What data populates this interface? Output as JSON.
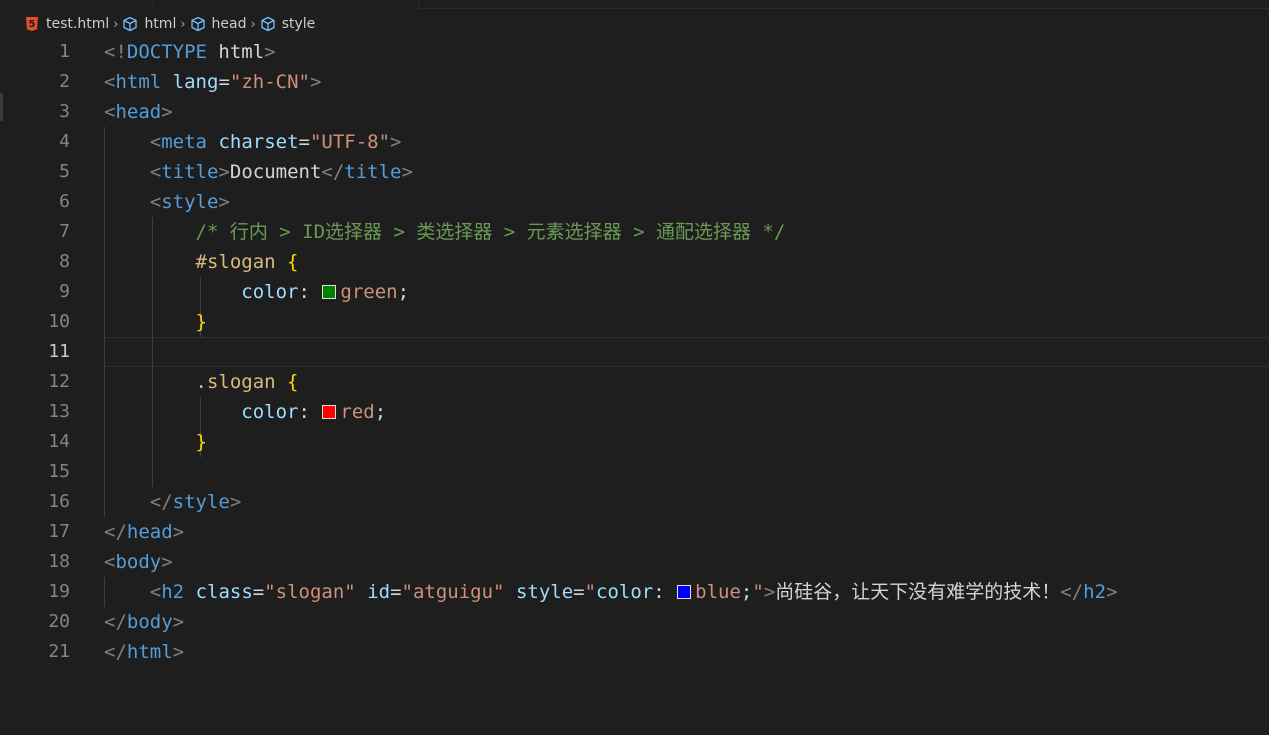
{
  "breadcrumb": {
    "items": [
      {
        "label": "test.html",
        "icon": "html5-file-icon"
      },
      {
        "label": "html",
        "icon": "symbol-cube-icon"
      },
      {
        "label": "head",
        "icon": "symbol-cube-icon"
      },
      {
        "label": "style",
        "icon": "symbol-cube-icon"
      }
    ]
  },
  "editor": {
    "current_line": 11,
    "line_numbers": [
      "1",
      "2",
      "3",
      "4",
      "5",
      "6",
      "7",
      "8",
      "9",
      "10",
      "11",
      "12",
      "13",
      "14",
      "15",
      "16",
      "17",
      "18",
      "19",
      "20",
      "21"
    ],
    "colors": {
      "swatch_green": "#008000",
      "swatch_red": "#ff0000",
      "swatch_blue": "#0000ff"
    },
    "lines": [
      [
        [
          "punc",
          "<!"
        ],
        [
          "doc",
          "DOCTYPE "
        ],
        [
          "text",
          "html"
        ],
        [
          "punc",
          ">"
        ]
      ],
      [
        [
          "punc",
          "<"
        ],
        [
          "tag",
          "html"
        ],
        [
          "text",
          " "
        ],
        [
          "attr",
          "lang"
        ],
        [
          "text",
          "="
        ],
        [
          "str",
          "\"zh-CN\""
        ],
        [
          "punc",
          ">"
        ]
      ],
      [
        [
          "punc",
          "<"
        ],
        [
          "tag",
          "head"
        ],
        [
          "punc",
          ">"
        ]
      ],
      [
        [
          "text",
          "    "
        ],
        [
          "punc",
          "<"
        ],
        [
          "tag",
          "meta"
        ],
        [
          "text",
          " "
        ],
        [
          "attr",
          "charset"
        ],
        [
          "text",
          "="
        ],
        [
          "str",
          "\"UTF-8\""
        ],
        [
          "punc",
          ">"
        ]
      ],
      [
        [
          "text",
          "    "
        ],
        [
          "punc",
          "<"
        ],
        [
          "tag",
          "title"
        ],
        [
          "punc",
          ">"
        ],
        [
          "text",
          "Document"
        ],
        [
          "punc",
          "</"
        ],
        [
          "tag",
          "title"
        ],
        [
          "punc",
          ">"
        ]
      ],
      [
        [
          "text",
          "    "
        ],
        [
          "punc",
          "<"
        ],
        [
          "tag",
          "style"
        ],
        [
          "punc",
          ">"
        ]
      ],
      [
        [
          "text",
          "        "
        ],
        [
          "com",
          "/* 行内 > ID选择器 > 类选择器 > 元素选择器 > 通配选择器 */"
        ]
      ],
      [
        [
          "text",
          "        "
        ],
        [
          "sel",
          "#slogan"
        ],
        [
          "text",
          " "
        ],
        [
          "brace",
          "{"
        ]
      ],
      [
        [
          "text",
          "            "
        ],
        [
          "prop",
          "color"
        ],
        [
          "text",
          ": "
        ],
        [
          "swatch",
          "green"
        ],
        [
          "val",
          "green"
        ],
        [
          "text",
          ";"
        ]
      ],
      [
        [
          "text",
          "        "
        ],
        [
          "brace",
          "}"
        ]
      ],
      [],
      [
        [
          "text",
          "        "
        ],
        [
          "sel",
          ".slogan"
        ],
        [
          "text",
          " "
        ],
        [
          "brace",
          "{"
        ]
      ],
      [
        [
          "text",
          "            "
        ],
        [
          "prop",
          "color"
        ],
        [
          "text",
          ": "
        ],
        [
          "swatch",
          "red"
        ],
        [
          "val",
          "red"
        ],
        [
          "text",
          ";"
        ]
      ],
      [
        [
          "text",
          "        "
        ],
        [
          "brace",
          "}"
        ]
      ],
      [],
      [
        [
          "text",
          "    "
        ],
        [
          "punc",
          "</"
        ],
        [
          "tag",
          "style"
        ],
        [
          "punc",
          ">"
        ]
      ],
      [
        [
          "punc",
          "</"
        ],
        [
          "tag",
          "head"
        ],
        [
          "punc",
          ">"
        ]
      ],
      [
        [
          "punc",
          "<"
        ],
        [
          "tag",
          "body"
        ],
        [
          "punc",
          ">"
        ]
      ],
      [
        [
          "text",
          "    "
        ],
        [
          "punc",
          "<"
        ],
        [
          "tag",
          "h2"
        ],
        [
          "text",
          " "
        ],
        [
          "attr",
          "class"
        ],
        [
          "text",
          "="
        ],
        [
          "str",
          "\"slogan\""
        ],
        [
          "text",
          " "
        ],
        [
          "attr",
          "id"
        ],
        [
          "text",
          "="
        ],
        [
          "str",
          "\"atguigu\""
        ],
        [
          "text",
          " "
        ],
        [
          "attr",
          "style"
        ],
        [
          "text",
          "="
        ],
        [
          "str",
          "\""
        ],
        [
          "prop",
          "color"
        ],
        [
          "text",
          ": "
        ],
        [
          "swatch",
          "blue"
        ],
        [
          "val",
          "blue"
        ],
        [
          "text",
          ";"
        ],
        [
          "str",
          "\""
        ],
        [
          "punc",
          ">"
        ],
        [
          "text",
          "尚硅谷，让天下没有难学的技术！"
        ],
        [
          "punc",
          "</"
        ],
        [
          "tag",
          "h2"
        ],
        [
          "punc",
          ">"
        ]
      ],
      [
        [
          "punc",
          "</"
        ],
        [
          "tag",
          "body"
        ],
        [
          "punc",
          ">"
        ]
      ],
      [
        [
          "punc",
          "</"
        ],
        [
          "tag",
          "html"
        ],
        [
          "punc",
          ">"
        ]
      ]
    ]
  }
}
